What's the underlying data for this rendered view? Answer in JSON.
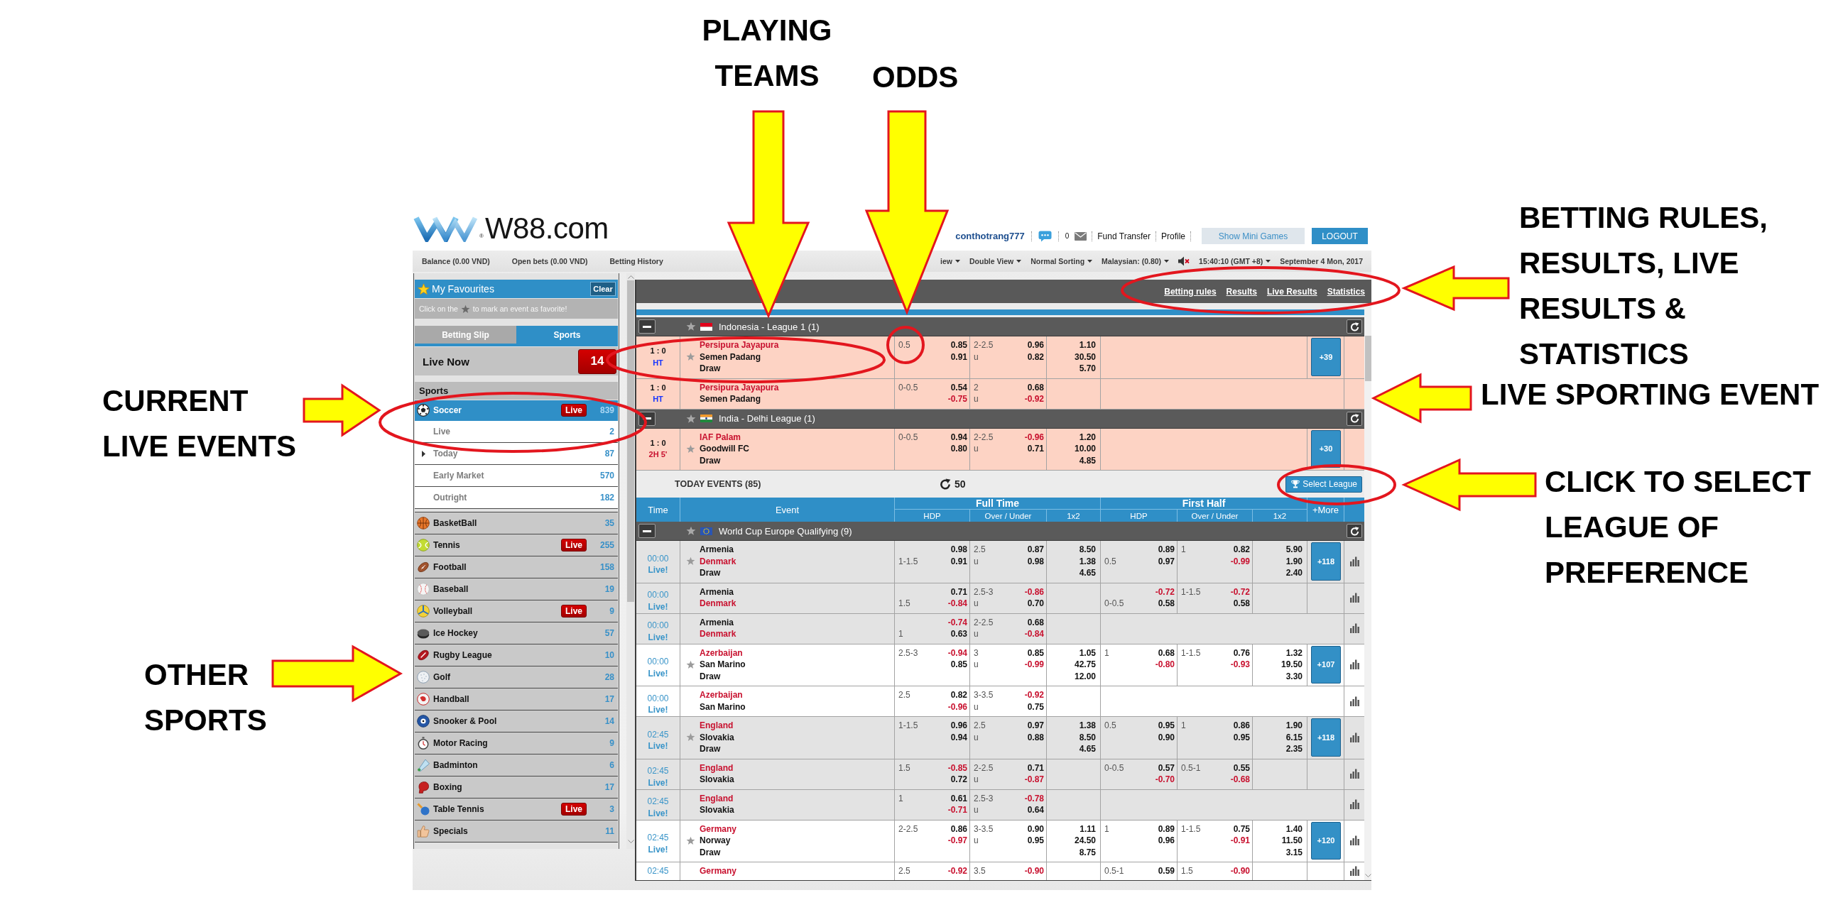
{
  "annotations": [
    {
      "kind": "teams",
      "text": "PLAYING TEAMS"
    },
    {
      "kind": "odds",
      "text": "ODDS"
    },
    {
      "kind": "links",
      "text": "BETTING RULES, RESULTS, LIVE RESULTS & STATISTICS"
    },
    {
      "kind": "current",
      "text": "CURRENT LIVE EVENTS"
    },
    {
      "kind": "event",
      "text": "LIVE SPORTING EVENT"
    },
    {
      "kind": "league",
      "text": "CLICK TO SELECT LEAGUE OF PREFERENCE"
    },
    {
      "kind": "sports",
      "text": "OTHER SPORTS"
    }
  ],
  "header": {
    "logo_mark": "®",
    "logo_text": "W88.com",
    "username": "conthotrang777",
    "message_count": "0",
    "links": [
      "Fund Transfer",
      "Profile"
    ],
    "mini_games_button": "Show Mini Games",
    "logout_button": "LOGOUT"
  },
  "account_bar": {
    "items": [
      "Balance (0.00 VND)",
      "Open bets (0.00 VND)",
      "Betting History"
    ],
    "menus": [
      "iew",
      "Double View",
      "Normal Sorting",
      "Malaysian: (0.80)"
    ],
    "clock": "15:40:10 (GMT +8)",
    "date": "September 4 Mon, 2017"
  },
  "sidebar": {
    "favourites": {
      "title": "My Favourites",
      "clear_button": "Clear",
      "hint_start": "Click on the",
      "hint_end": "to mark an event as favorite!"
    },
    "tabs": [
      {
        "label": "Betting Slip",
        "selected": false
      },
      {
        "label": "Sports",
        "selected": true
      }
    ],
    "live_now": {
      "label": "Live Now",
      "count": "14"
    },
    "heading": "Sports",
    "sports": [
      {
        "name": "Soccer",
        "kind": "soccer",
        "badge": "Live",
        "count": "839",
        "selected": true,
        "children": [
          {
            "name": "Live",
            "count": "2",
            "expandable": false
          },
          {
            "name": "Today",
            "count": "87",
            "expandable": true
          },
          {
            "name": "Early Market",
            "count": "570",
            "expandable": false
          },
          {
            "name": "Outright",
            "count": "182",
            "expandable": false
          }
        ]
      },
      {
        "name": "BasketBall",
        "kind": "basketball",
        "count": "35",
        "selected": false
      },
      {
        "name": "Tennis",
        "kind": "tennis",
        "badge": "Live",
        "count": "255",
        "selected": false
      },
      {
        "name": "Football",
        "kind": "football",
        "count": "158",
        "selected": false
      },
      {
        "name": "Baseball",
        "kind": "baseball",
        "count": "19",
        "selected": false
      },
      {
        "name": "Volleyball",
        "kind": "volleyball",
        "badge": "Live",
        "count": "9",
        "selected": false
      },
      {
        "name": "Ice Hockey",
        "kind": "hockey",
        "count": "57",
        "selected": false
      },
      {
        "name": "Rugby League",
        "kind": "rugby",
        "count": "10",
        "selected": false
      },
      {
        "name": "Golf",
        "kind": "golf",
        "count": "28",
        "selected": false
      },
      {
        "name": "Handball",
        "kind": "handball",
        "count": "17",
        "selected": false
      },
      {
        "name": "Snooker & Pool",
        "kind": "snooker",
        "count": "14",
        "selected": false
      },
      {
        "name": "Motor Racing",
        "kind": "racing",
        "count": "9",
        "selected": false
      },
      {
        "name": "Badminton",
        "kind": "badminton",
        "count": "6",
        "selected": false
      },
      {
        "name": "Boxing",
        "kind": "boxing",
        "count": "17",
        "selected": false
      },
      {
        "name": "Table Tennis",
        "kind": "pingpong",
        "badge": "Live",
        "count": "3",
        "selected": false
      },
      {
        "name": "Specials",
        "kind": "specials",
        "count": "11",
        "selected": false
      }
    ]
  },
  "main": {
    "toolbar_links": [
      "Betting rules",
      "Results",
      "Live Results",
      "Statistics"
    ],
    "live_leagues": [
      {
        "name": "Indonesia - League 1 (1)",
        "kind": "indonesia",
        "events": [
          {
            "time": {
              "kind": "live",
              "score": "1 : 0",
              "period": "HT",
              "running": false
            },
            "teams": [
              {
                "name": "Persipura Jayapura",
                "favourite": true
              },
              {
                "name": "Semen Padang",
                "favourite": false
              }
            ],
            "draw": "Draw",
            "star": true,
            "full_time": {
              "hdp": {
                "home_line": "0.5",
                "odds": [
                  {
                    "value": "0.85",
                    "negative": false
                  },
                  {
                    "value": "0.91",
                    "negative": false
                  }
                ]
              },
              "ou": {
                "line": "2-2.5",
                "under": "u",
                "odds": [
                  {
                    "value": "0.96",
                    "negative": false
                  },
                  {
                    "value": "0.82",
                    "negative": false
                  }
                ]
              },
              "x12": [
                "1.10",
                "30.50",
                "5.70"
              ]
            },
            "more": "+39",
            "stats": false
          },
          {
            "time": {
              "kind": "live",
              "score": "1 : 0",
              "period": "HT",
              "running": false
            },
            "teams": [
              {
                "name": "Persipura Jayapura",
                "favourite": true
              },
              {
                "name": "Semen Padang",
                "favourite": false
              }
            ],
            "star": false,
            "full_time": {
              "hdp": {
                "home_line": "0-0.5",
                "odds": [
                  {
                    "value": "0.54",
                    "negative": false
                  },
                  {
                    "value": "-0.75",
                    "negative": true
                  }
                ]
              },
              "ou": {
                "line": "2",
                "under": "u",
                "odds": [
                  {
                    "value": "0.68",
                    "negative": false
                  },
                  {
                    "value": "-0.92",
                    "negative": true
                  }
                ]
              }
            },
            "stats": false
          }
        ]
      },
      {
        "name": "India - Delhi League (1)",
        "kind": "india",
        "events": [
          {
            "time": {
              "kind": "live",
              "score": "1 : 0",
              "period": "2H 5'",
              "running": true
            },
            "teams": [
              {
                "name": "IAF Palam",
                "favourite": true
              },
              {
                "name": "Goodwill FC",
                "favourite": false
              }
            ],
            "draw": "Draw",
            "star": true,
            "full_time": {
              "hdp": {
                "home_line": "0-0.5",
                "odds": [
                  {
                    "value": "0.94",
                    "negative": false
                  },
                  {
                    "value": "0.80",
                    "negative": false
                  }
                ]
              },
              "ou": {
                "line": "2-2.5",
                "under": "u",
                "odds": [
                  {
                    "value": "-0.96",
                    "negative": true
                  },
                  {
                    "value": "0.71",
                    "negative": false
                  }
                ]
              },
              "x12": [
                "1.20",
                "10.00",
                "4.85"
              ]
            },
            "more": "+30",
            "stats": false
          }
        ]
      }
    ],
    "today_bar": {
      "title": "TODAY EVENTS (85)",
      "refresh_count": "50",
      "select_button": "Select League"
    },
    "columns": {
      "time": "Time",
      "event": "Event",
      "groups": [
        {
          "label": "Full Time",
          "columns": [
            "HDP",
            "Over / Under",
            "1x2"
          ]
        },
        {
          "label": "First Half",
          "columns": [
            "HDP",
            "Over / Under",
            "1x2"
          ]
        }
      ],
      "more": "+More"
    },
    "today_leagues": [
      {
        "name": "World Cup Europe Qualifying (9)",
        "kind": "eu",
        "events": [
          {
            "time": {
              "kind": "scheduled",
              "clock": "00:00",
              "note": "Live!"
            },
            "teams": [
              {
                "name": "Armenia",
                "favourite": false
              },
              {
                "name": "Denmark",
                "favourite": true
              }
            ],
            "draw": "Draw",
            "star": true,
            "shaded": true,
            "full_time": {
              "hdp": {
                "away_line": "1-1.5",
                "odds": [
                  {
                    "value": "0.98",
                    "negative": false
                  },
                  {
                    "value": "0.91",
                    "negative": false
                  }
                ]
              },
              "ou": {
                "line": "2.5",
                "under": "u",
                "odds": [
                  {
                    "value": "0.87",
                    "negative": false
                  },
                  {
                    "value": "0.98",
                    "negative": false
                  }
                ]
              },
              "x12": [
                "8.50",
                "1.38",
                "4.65"
              ]
            },
            "first_half": {
              "hdp": {
                "away_line": "0.5",
                "odds": [
                  {
                    "value": "0.89",
                    "negative": false
                  },
                  {
                    "value": "0.97",
                    "negative": false
                  }
                ]
              },
              "ou": {
                "line": "1",
                "odds": [
                  {
                    "value": "0.82",
                    "negative": false
                  },
                  {
                    "value": "-0.99",
                    "negative": true
                  }
                ]
              },
              "x12": [
                "5.90",
                "1.90",
                "2.40"
              ]
            },
            "more": "+118",
            "stats": true
          },
          {
            "time": {
              "kind": "scheduled",
              "clock": "00:00",
              "note": "Live!"
            },
            "teams": [
              {
                "name": "Armenia",
                "favourite": false
              },
              {
                "name": "Denmark",
                "favourite": true
              }
            ],
            "star": false,
            "shaded": true,
            "full_time": {
              "hdp": {
                "away_line": "1.5",
                "odds": [
                  {
                    "value": "0.71",
                    "negative": false
                  },
                  {
                    "value": "-0.84",
                    "negative": true
                  }
                ]
              },
              "ou": {
                "line": "2.5-3",
                "under": "u",
                "odds": [
                  {
                    "value": "-0.86",
                    "negative": true
                  },
                  {
                    "value": "0.70",
                    "negative": false
                  }
                ]
              }
            },
            "first_half": {
              "hdp": {
                "away_line": "0-0.5",
                "odds": [
                  {
                    "value": "-0.72",
                    "negative": true
                  },
                  {
                    "value": "0.58",
                    "negative": false
                  }
                ]
              },
              "ou": {
                "line": "1-1.5",
                "odds": [
                  {
                    "value": "-0.72",
                    "negative": true
                  },
                  {
                    "value": "0.58",
                    "negative": false
                  }
                ]
              }
            },
            "stats": true
          },
          {
            "time": {
              "kind": "scheduled",
              "clock": "00:00",
              "note": "Live!"
            },
            "teams": [
              {
                "name": "Armenia",
                "favourite": false
              },
              {
                "name": "Denmark",
                "favourite": true
              }
            ],
            "star": false,
            "shaded": true,
            "full_time": {
              "hdp": {
                "away_line": "1",
                "odds": [
                  {
                    "value": "-0.74",
                    "negative": true
                  },
                  {
                    "value": "0.63",
                    "negative": false
                  }
                ]
              },
              "ou": {
                "line": "2-2.5",
                "under": "u",
                "odds": [
                  {
                    "value": "0.68",
                    "negative": false
                  },
                  {
                    "value": "-0.84",
                    "negative": true
                  }
                ]
              }
            },
            "stats": true
          },
          {
            "time": {
              "kind": "scheduled",
              "clock": "00:00",
              "note": "Live!"
            },
            "teams": [
              {
                "name": "Azerbaijan",
                "favourite": true
              },
              {
                "name": "San Marino",
                "favourite": false
              }
            ],
            "draw": "Draw",
            "star": true,
            "shaded": false,
            "full_time": {
              "hdp": {
                "home_line": "2.5-3",
                "odds": [
                  {
                    "value": "-0.94",
                    "negative": true
                  },
                  {
                    "value": "0.85",
                    "negative": false
                  }
                ]
              },
              "ou": {
                "line": "3",
                "under": "u",
                "odds": [
                  {
                    "value": "0.85",
                    "negative": false
                  },
                  {
                    "value": "-0.99",
                    "negative": true
                  }
                ]
              },
              "x12": [
                "1.05",
                "42.75",
                "12.00"
              ]
            },
            "first_half": {
              "hdp": {
                "home_line": "1",
                "odds": [
                  {
                    "value": "0.68",
                    "negative": false
                  },
                  {
                    "value": "-0.80",
                    "negative": true
                  }
                ]
              },
              "ou": {
                "line": "1-1.5",
                "odds": [
                  {
                    "value": "0.76",
                    "negative": false
                  },
                  {
                    "value": "-0.93",
                    "negative": true
                  }
                ]
              },
              "x12": [
                "1.32",
                "19.50",
                "3.30"
              ]
            },
            "more": "+107",
            "stats": true
          },
          {
            "time": {
              "kind": "scheduled",
              "clock": "00:00",
              "note": "Live!"
            },
            "teams": [
              {
                "name": "Azerbaijan",
                "favourite": true
              },
              {
                "name": "San Marino",
                "favourite": false
              }
            ],
            "star": false,
            "shaded": false,
            "full_time": {
              "hdp": {
                "home_line": "2.5",
                "odds": [
                  {
                    "value": "0.82",
                    "negative": false
                  },
                  {
                    "value": "-0.96",
                    "negative": true
                  }
                ]
              },
              "ou": {
                "line": "3-3.5",
                "under": "u",
                "odds": [
                  {
                    "value": "-0.92",
                    "negative": true
                  },
                  {
                    "value": "0.75",
                    "negative": false
                  }
                ]
              }
            },
            "stats": true
          },
          {
            "time": {
              "kind": "scheduled",
              "clock": "02:45",
              "note": "Live!"
            },
            "teams": [
              {
                "name": "England",
                "favourite": true
              },
              {
                "name": "Slovakia",
                "favourite": false
              }
            ],
            "draw": "Draw",
            "star": true,
            "shaded": true,
            "full_time": {
              "hdp": {
                "home_line": "1-1.5",
                "odds": [
                  {
                    "value": "0.96",
                    "negative": false
                  },
                  {
                    "value": "0.94",
                    "negative": false
                  }
                ]
              },
              "ou": {
                "line": "2.5",
                "under": "u",
                "odds": [
                  {
                    "value": "0.97",
                    "negative": false
                  },
                  {
                    "value": "0.88",
                    "negative": false
                  }
                ]
              },
              "x12": [
                "1.38",
                "8.50",
                "4.65"
              ]
            },
            "first_half": {
              "hdp": {
                "home_line": "0.5",
                "odds": [
                  {
                    "value": "0.95",
                    "negative": false
                  },
                  {
                    "value": "0.90",
                    "negative": false
                  }
                ]
              },
              "ou": {
                "line": "1",
                "odds": [
                  {
                    "value": "0.86",
                    "negative": false
                  },
                  {
                    "value": "0.95",
                    "negative": false
                  }
                ]
              },
              "x12": [
                "1.90",
                "6.15",
                "2.35"
              ]
            },
            "more": "+118",
            "stats": true
          },
          {
            "time": {
              "kind": "scheduled",
              "clock": "02:45",
              "note": "Live!"
            },
            "teams": [
              {
                "name": "England",
                "favourite": true
              },
              {
                "name": "Slovakia",
                "favourite": false
              }
            ],
            "star": false,
            "shaded": true,
            "full_time": {
              "hdp": {
                "home_line": "1.5",
                "odds": [
                  {
                    "value": "-0.85",
                    "negative": true
                  },
                  {
                    "value": "0.72",
                    "negative": false
                  }
                ]
              },
              "ou": {
                "line": "2-2.5",
                "under": "u",
                "odds": [
                  {
                    "value": "0.71",
                    "negative": false
                  },
                  {
                    "value": "-0.87",
                    "negative": true
                  }
                ]
              }
            },
            "first_half": {
              "hdp": {
                "home_line": "0-0.5",
                "odds": [
                  {
                    "value": "0.57",
                    "negative": false
                  },
                  {
                    "value": "-0.70",
                    "negative": true
                  }
                ]
              },
              "ou": {
                "line": "0.5-1",
                "odds": [
                  {
                    "value": "0.55",
                    "negative": false
                  },
                  {
                    "value": "-0.68",
                    "negative": true
                  }
                ]
              }
            },
            "stats": true
          },
          {
            "time": {
              "kind": "scheduled",
              "clock": "02:45",
              "note": "Live!"
            },
            "teams": [
              {
                "name": "England",
                "favourite": true
              },
              {
                "name": "Slovakia",
                "favourite": false
              }
            ],
            "star": false,
            "shaded": true,
            "full_time": {
              "hdp": {
                "home_line": "1",
                "odds": [
                  {
                    "value": "0.61",
                    "negative": false
                  },
                  {
                    "value": "-0.71",
                    "negative": true
                  }
                ]
              },
              "ou": {
                "line": "2.5-3",
                "under": "u",
                "odds": [
                  {
                    "value": "-0.78",
                    "negative": true
                  },
                  {
                    "value": "0.64",
                    "negative": false
                  }
                ]
              }
            },
            "stats": true
          },
          {
            "time": {
              "kind": "scheduled",
              "clock": "02:45",
              "note": "Live!"
            },
            "teams": [
              {
                "name": "Germany",
                "favourite": true
              },
              {
                "name": "Norway",
                "favourite": false
              }
            ],
            "draw": "Draw",
            "star": true,
            "shaded": false,
            "full_time": {
              "hdp": {
                "home_line": "2-2.5",
                "odds": [
                  {
                    "value": "0.86",
                    "negative": false
                  },
                  {
                    "value": "-0.97",
                    "negative": true
                  }
                ]
              },
              "ou": {
                "line": "3-3.5",
                "under": "u",
                "odds": [
                  {
                    "value": "0.90",
                    "negative": false
                  },
                  {
                    "value": "0.95",
                    "negative": false
                  }
                ]
              },
              "x12": [
                "1.11",
                "24.50",
                "8.75"
              ]
            },
            "first_half": {
              "hdp": {
                "home_line": "1",
                "odds": [
                  {
                    "value": "0.89",
                    "negative": false
                  },
                  {
                    "value": "0.96",
                    "negative": false
                  }
                ]
              },
              "ou": {
                "line": "1-1.5",
                "odds": [
                  {
                    "value": "0.75",
                    "negative": false
                  },
                  {
                    "value": "-0.91",
                    "negative": true
                  }
                ]
              },
              "x12": [
                "1.40",
                "11.50",
                "3.15"
              ]
            },
            "more": "+120",
            "stats": true
          },
          {
            "time": {
              "kind": "scheduled",
              "clock": "02:45"
            },
            "teams": [
              {
                "name": "Germany",
                "favourite": true
              }
            ],
            "star": false,
            "shaded": false,
            "full_time": {
              "hdp": {
                "home_line": "2.5",
                "odds": [
                  {
                    "value": "-0.92",
                    "negative": true
                  }
                ]
              },
              "ou": {
                "line": "3.5",
                "odds": [
                  {
                    "value": "-0.90",
                    "negative": true
                  }
                ]
              }
            },
            "first_half": {
              "hdp": {
                "home_line": "0.5-1",
                "odds": [
                  {
                    "value": "0.59",
                    "negative": false
                  }
                ]
              },
              "ou": {
                "line": "1.5",
                "odds": [
                  {
                    "value": "-0.90",
                    "negative": true
                  }
                ]
              }
            },
            "stats": true
          }
        ]
      }
    ]
  }
}
